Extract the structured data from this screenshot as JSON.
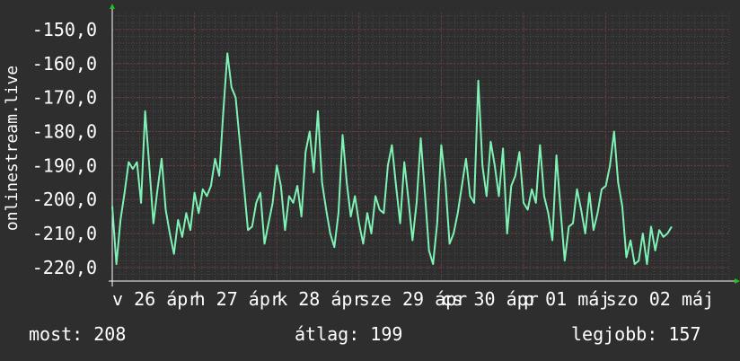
{
  "chart_data": {
    "type": "line",
    "ylabel": "onlinestream.live",
    "ylim": [
      -224,
      -145
    ],
    "yticks": [
      -150,
      -160,
      -170,
      -180,
      -190,
      -200,
      -210,
      -220
    ],
    "ytick_labels": [
      "-150,0",
      "-160,0",
      "-170,0",
      "-180,0",
      "-190,0",
      "-200,0",
      "-210,0",
      "-220,0"
    ],
    "xlim": [
      0,
      7.5
    ],
    "xtick_labels": [
      "v 26 ápr",
      "h 27 ápr",
      "k 28 ápr",
      "sze 29 ápr",
      "cs 30 ápr",
      "p 01 máj",
      "szo 02 máj"
    ],
    "xtick_positions": [
      0,
      1,
      2,
      3,
      4,
      5,
      6
    ],
    "grid": true,
    "series": [
      {
        "color": "#7ef2b4",
        "x": [
          0,
          0.05,
          0.1,
          0.15,
          0.2,
          0.25,
          0.3,
          0.35,
          0.4,
          0.45,
          0.5,
          0.55,
          0.6,
          0.65,
          0.7,
          0.75,
          0.8,
          0.85,
          0.9,
          0.95,
          1.0,
          1.05,
          1.1,
          1.15,
          1.2,
          1.25,
          1.3,
          1.35,
          1.4,
          1.45,
          1.5,
          1.55,
          1.6,
          1.65,
          1.7,
          1.75,
          1.8,
          1.85,
          1.9,
          1.95,
          2.0,
          2.05,
          2.1,
          2.15,
          2.2,
          2.25,
          2.3,
          2.35,
          2.4,
          2.45,
          2.5,
          2.55,
          2.6,
          2.65,
          2.7,
          2.75,
          2.8,
          2.85,
          2.9,
          2.95,
          3.0,
          3.05,
          3.1,
          3.15,
          3.2,
          3.25,
          3.3,
          3.35,
          3.4,
          3.45,
          3.5,
          3.55,
          3.6,
          3.65,
          3.7,
          3.75,
          3.8,
          3.85,
          3.9,
          3.95,
          4.0,
          4.05,
          4.1,
          4.15,
          4.2,
          4.25,
          4.3,
          4.35,
          4.4,
          4.45,
          4.5,
          4.55,
          4.6,
          4.65,
          4.7,
          4.75,
          4.8,
          4.85,
          4.9,
          4.95,
          5.0,
          5.05,
          5.1,
          5.15,
          5.2,
          5.25,
          5.3,
          5.35,
          5.4,
          5.45,
          5.5,
          5.55,
          5.6,
          5.65,
          5.7,
          5.75,
          5.8,
          5.85,
          5.9,
          5.95,
          6.0,
          6.05,
          6.1,
          6.15,
          6.2,
          6.25,
          6.3,
          6.35,
          6.4,
          6.45,
          6.5,
          6.55,
          6.6,
          6.65,
          6.7,
          6.75,
          6.8
        ],
        "values": [
          -202,
          -219,
          -206,
          -198,
          -189,
          -191,
          -189,
          -201,
          -174,
          -190,
          -207,
          -197,
          -188,
          -203,
          -210,
          -216,
          -206,
          -211,
          -204,
          -209,
          -198,
          -204,
          -197,
          -199,
          -196,
          -188,
          -193,
          -174,
          -157,
          -167,
          -170,
          -183,
          -196,
          -209,
          -208,
          -201,
          -198,
          -213,
          -207,
          -201,
          -190,
          -196,
          -209,
          -199,
          -201,
          -196,
          -205,
          -186,
          -180,
          -192,
          -174,
          -195,
          -203,
          -210,
          -214,
          -204,
          -181,
          -195,
          -205,
          -199,
          -207,
          -213,
          -204,
          -210,
          -199,
          -203,
          -204,
          -190,
          -184,
          -196,
          -207,
          -189,
          -200,
          -212,
          -201,
          -182,
          -198,
          -215,
          -219,
          -207,
          -184,
          -195,
          -213,
          -210,
          -204,
          -196,
          -188,
          -199,
          -201,
          -165,
          -190,
          -199,
          -183,
          -190,
          -199,
          -185,
          -210,
          -196,
          -193,
          -186,
          -201,
          -203,
          -197,
          -201,
          -184,
          -199,
          -204,
          -212,
          -187,
          -203,
          -218,
          -208,
          -207,
          -197,
          -203,
          -210,
          -198,
          -209,
          -204,
          -197,
          -196,
          -190,
          -180,
          -195,
          -202,
          -217,
          -212,
          -219,
          -218,
          -210,
          -219,
          -208,
          -215,
          -209,
          -211,
          -210,
          -208
        ]
      }
    ]
  },
  "stats": {
    "current": "most: 208",
    "average": "átlag: 199",
    "best": "legjobb: 157"
  }
}
